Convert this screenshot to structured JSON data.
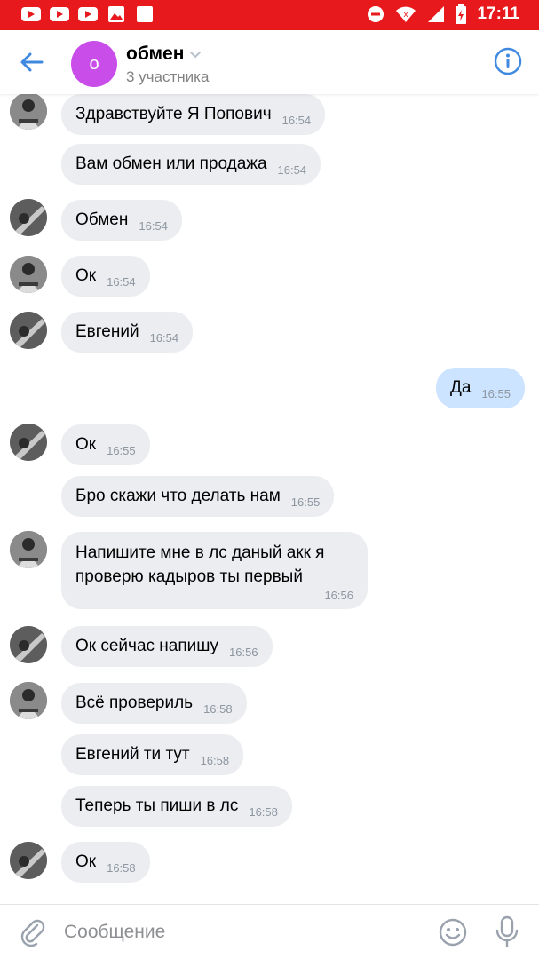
{
  "status_bar": {
    "time": "17:11",
    "colors": {
      "background": "#e8191c"
    },
    "left_icons": [
      "youtube-icon",
      "youtube-icon",
      "youtube-icon",
      "gallery-icon",
      "square-icon"
    ],
    "right_icons": [
      "dnd-icon",
      "wifi-icon",
      "signal-icon",
      "battery-icon"
    ]
  },
  "header": {
    "avatar_letter": "о",
    "title": "обмен",
    "subtitle": "3 участника",
    "colors": {
      "avatar": "#c94de8",
      "accent": "#3f8ae0"
    }
  },
  "messages": [
    {
      "text": "Здравствуйте  Я Попович",
      "time": "16:54"
    },
    {
      "text": "Вам обмен или продажа",
      "time": "16:54"
    },
    {
      "text": "Обмен",
      "time": "16:54"
    },
    {
      "text": "Ок",
      "time": "16:54"
    },
    {
      "text": "Евгений",
      "time": "16:54"
    },
    {
      "text": "Да",
      "time": "16:55"
    },
    {
      "text": "Ок",
      "time": "16:55"
    },
    {
      "text": "Бро скажи что делать нам",
      "time": "16:55"
    },
    {
      "text": "Напишите мне в лс даный акк я проверю кадыров ты первый",
      "time": "16:56"
    },
    {
      "text": "Ок сейчас напишу",
      "time": "16:56"
    },
    {
      "text": "Всё провериль",
      "time": "16:58"
    },
    {
      "text": "Евгений ти тут",
      "time": "16:58"
    },
    {
      "text": "Теперь ты пиши в лс",
      "time": "16:58"
    },
    {
      "text": "Ок",
      "time": "16:58"
    }
  ],
  "composer": {
    "placeholder": "Сообщение"
  }
}
